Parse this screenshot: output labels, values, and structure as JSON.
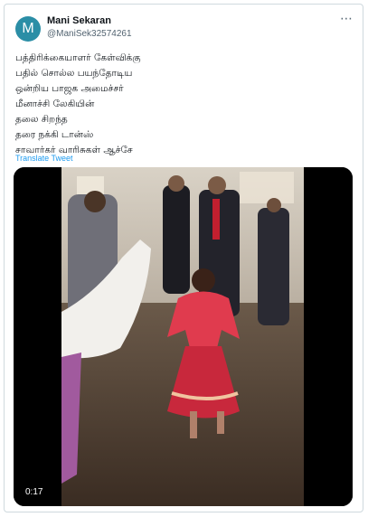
{
  "author": {
    "avatar_letter": "M",
    "name": "Mani Sekaran",
    "handle": "@ManiSek32574261",
    "more_icon": "⋯"
  },
  "tweet": {
    "lines": [
      "பத்திரிக்கையாளர் கேள்விக்கு",
      "பதில் சொல்ல பயந்தோடிய",
      "ஒன்றிய பாஜக அமைச்சர்",
      "மீனாச்சி லேகியின்",
      "தலை சிறந்த",
      "தரை நக்கி டான்ஸ்",
      "சாவார்கர் வாரிசுகள் ஆச்சே"
    ],
    "translate_label": "Translate Tweet"
  },
  "video": {
    "timestamp": "0:17"
  },
  "colors": {
    "avatar_bg": "#2b8ea6",
    "link": "#1d9bf0",
    "border": "#cfd9de"
  }
}
